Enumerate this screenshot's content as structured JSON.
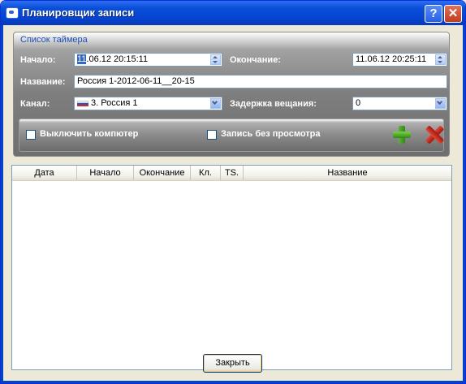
{
  "window": {
    "title": "Планировщик записи"
  },
  "titlebar": {
    "help_label": "?",
    "close_label": "✕"
  },
  "timer": {
    "section_title": "Список таймера",
    "start_label": "Начало:",
    "start_value_selected": "11",
    "start_value_rest": ".06.12 20:15:11",
    "end_label": "Окончание:",
    "end_value": "11.06.12 20:25:11",
    "name_label": "Название:",
    "name_value": "Россия 1-2012-06-11__20-15",
    "channel_label": "Канал:",
    "channel_value": "3. Россия 1",
    "delay_label": "Задержка вещания:",
    "delay_value": "0"
  },
  "options": {
    "shutdown_label": "Выключить компютер",
    "shutdown_checked": false,
    "record_no_view_label": "Запись без просмотра",
    "record_no_view_checked": false
  },
  "table": {
    "columns": [
      "Дата",
      "Начало",
      "Окончание",
      "Кл.",
      "TS.",
      "Название"
    ],
    "rows": []
  },
  "footer": {
    "close_label": "Закрыть"
  },
  "icons": {
    "app": "app-icon",
    "add": "plus-icon",
    "delete": "delete-icon",
    "channel_flag": "flag-icon"
  },
  "colors": {
    "titlebar": "#0a4fd8",
    "section_title": "#1c4fb4",
    "add_icon": "#2f8a17",
    "delete_icon": "#c0261a"
  }
}
